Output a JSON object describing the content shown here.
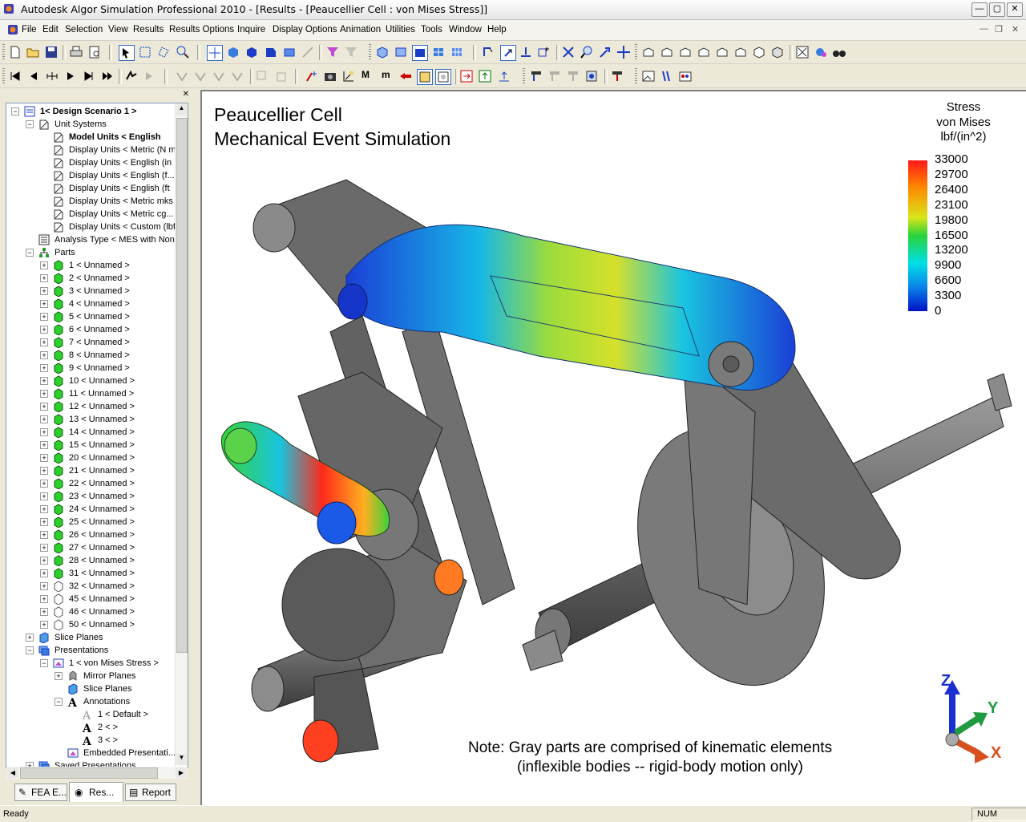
{
  "window": {
    "title": "Autodesk Algor Simulation Professional 2010 - [Results - [Peaucellier Cell : von Mises Stress]]",
    "min_symbol": "—",
    "max_symbol": "▢",
    "close_symbol": "✕"
  },
  "menu": {
    "items": [
      "File",
      "Edit",
      "Selection",
      "View",
      "Results",
      "Results Options",
      "Inquire",
      "Display Options",
      "Animation",
      "Utilities",
      "Tools",
      "Window",
      "Help"
    ],
    "mdi_min": "—",
    "mdi_restore": "❐",
    "mdi_close": "✕"
  },
  "tree": {
    "root": "1< Design Scenario 1 >",
    "unit_systems": "Unit Systems",
    "units": [
      "Model Units < English",
      "Display Units < Metric (N m",
      "Display Units < English (in",
      "Display Units < English (f...",
      "Display Units < English (ft",
      "Display Units < Metric mks",
      "Display Units < Metric cg...",
      "Display Units < Custom (lbf"
    ],
    "analysis_type": "Analysis Type < MES with Nonl",
    "parts_label": "Parts",
    "parts": [
      "1 < Unnamed >",
      "2 < Unnamed >",
      "3 < Unnamed >",
      "4 < Unnamed >",
      "5 < Unnamed >",
      "6 < Unnamed >",
      "7 < Unnamed >",
      "8 < Unnamed >",
      "9 < Unnamed >",
      "10 < Unnamed >",
      "11 < Unnamed >",
      "12 < Unnamed >",
      "13 < Unnamed >",
      "14 < Unnamed >",
      "15 < Unnamed >",
      "20 < Unnamed >",
      "21 < Unnamed >",
      "22 < Unnamed >",
      "23 < Unnamed >",
      "24 < Unnamed >",
      "25 < Unnamed >",
      "26 < Unnamed >",
      "27 < Unnamed >",
      "28 < Unnamed >",
      "31 < Unnamed >",
      "32 < Unnamed >",
      "45 < Unnamed >",
      "46 < Unnamed >",
      "50 < Unnamed >"
    ],
    "slice_planes": "Slice Planes",
    "presentations": "Presentations",
    "presentation_1": "1 < von Mises Stress >",
    "mirror_planes": "Mirror Planes",
    "slice_planes_sub": "Slice Planes",
    "annotations": "Annotations",
    "annotation_items": [
      "1 < Default >",
      "2 < >",
      "3 < >"
    ],
    "embedded": "Embedded Presentati...",
    "saved_presentations": "Saved Presentations"
  },
  "bottom_tabs": [
    "FEA E...",
    "Res...",
    "Report"
  ],
  "viewport": {
    "heading_1": "Peaucellier Cell",
    "heading_2": "Mechanical Event Simulation",
    "legend": {
      "title_1": "Stress",
      "title_2": "von Mises",
      "title_3": "lbf/(in^2)",
      "values": [
        "33000",
        "29700",
        "26400",
        "23100",
        "19800",
        "16500",
        "13200",
        "9900",
        "6600",
        "3300",
        "0"
      ]
    },
    "note_1": "Note:  Gray parts are comprised of kinematic elements",
    "note_2": "(inflexible bodies -- rigid-body motion only)",
    "axis": {
      "z": "Z",
      "y": "Y",
      "x": "X"
    }
  },
  "status": {
    "left": "Ready",
    "right": "NUM"
  },
  "colors": {
    "accent_blue": "#1a3fd6",
    "gray_part": "#6e6e6e",
    "viewport_bg": "#ffffff"
  }
}
